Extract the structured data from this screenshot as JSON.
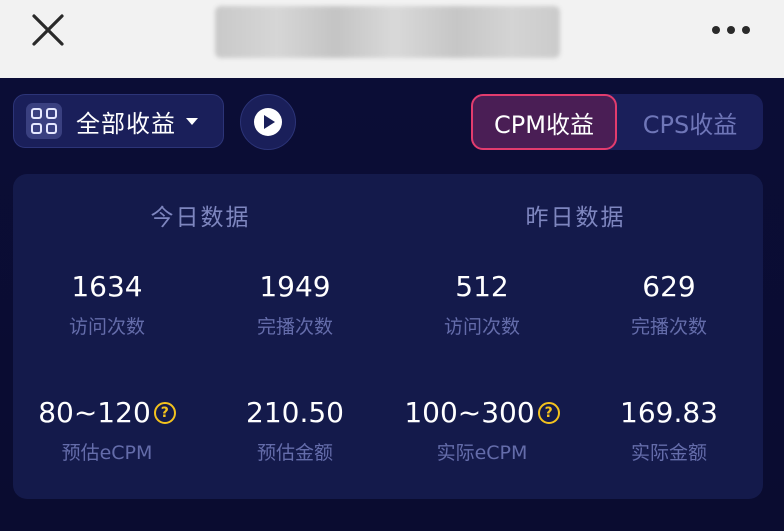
{
  "header": {
    "close_icon": "close-icon",
    "more_icon": "more-dots-icon"
  },
  "toolbar": {
    "dropdown_label": "全部收益",
    "dropdown_icon": "grid-icon",
    "play_icon": "play-icon",
    "tabs": [
      {
        "label": "CPM收益",
        "active": true
      },
      {
        "label": "CPS收益",
        "active": false
      }
    ]
  },
  "colors": {
    "background": "#0b0d33",
    "panel": "#141a4b",
    "accent": "#e23c6e",
    "help_icon": "#f3c21e"
  },
  "stats": {
    "today": {
      "title": "今日数据",
      "visits": {
        "value": "1634",
        "label": "访问次数"
      },
      "plays": {
        "value": "1949",
        "label": "完播次数"
      },
      "ecpm": {
        "value": "80~120",
        "label": "预估eCPM"
      },
      "amount": {
        "value": "210.50",
        "label": "预估金额"
      }
    },
    "yesterday": {
      "title": "昨日数据",
      "visits": {
        "value": "512",
        "label": "访问次数"
      },
      "plays": {
        "value": "629",
        "label": "完播次数"
      },
      "ecpm": {
        "value": "100~300",
        "label": "实际eCPM"
      },
      "amount": {
        "value": "169.83",
        "label": "实际金额"
      }
    },
    "help_glyph": "?"
  }
}
